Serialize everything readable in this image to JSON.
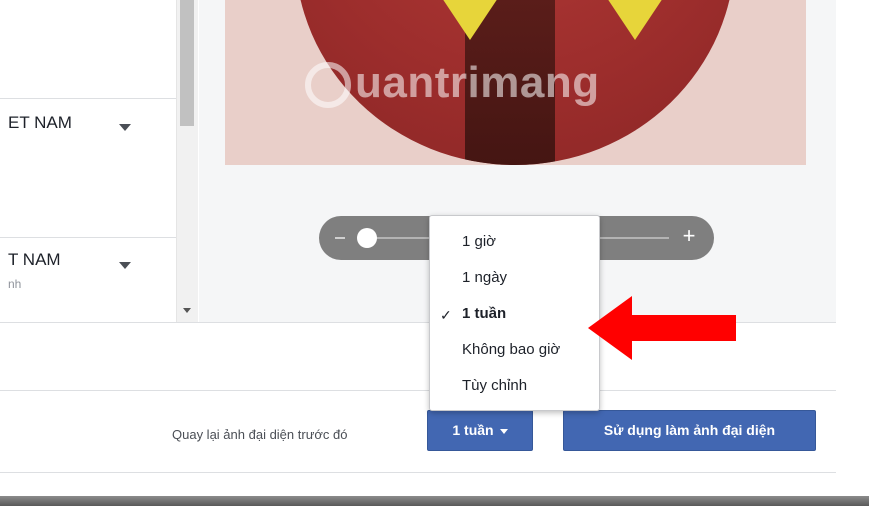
{
  "left_panel": {
    "rows": [
      {
        "country": "ET NAM"
      },
      {
        "country": "T NAM",
        "subtext": "nh"
      }
    ]
  },
  "preview": {
    "watermark": "uantrimang"
  },
  "zoom": {
    "plus": "+",
    "level": 0.1
  },
  "menu": {
    "items": [
      "1 giờ",
      "1 ngày",
      "1 tuần",
      "Không bao giờ",
      "Tùy chỉnh"
    ],
    "selected_index": 2,
    "check": "✓"
  },
  "footer": {
    "revert_label": "Quay lại ảnh đại diện trước đó",
    "duration_value": "1 tuần",
    "use_button": "Sử dụng làm ảnh đại diện"
  },
  "colors": {
    "primary_button": "#4267b2",
    "arrow": "#ff0000"
  }
}
